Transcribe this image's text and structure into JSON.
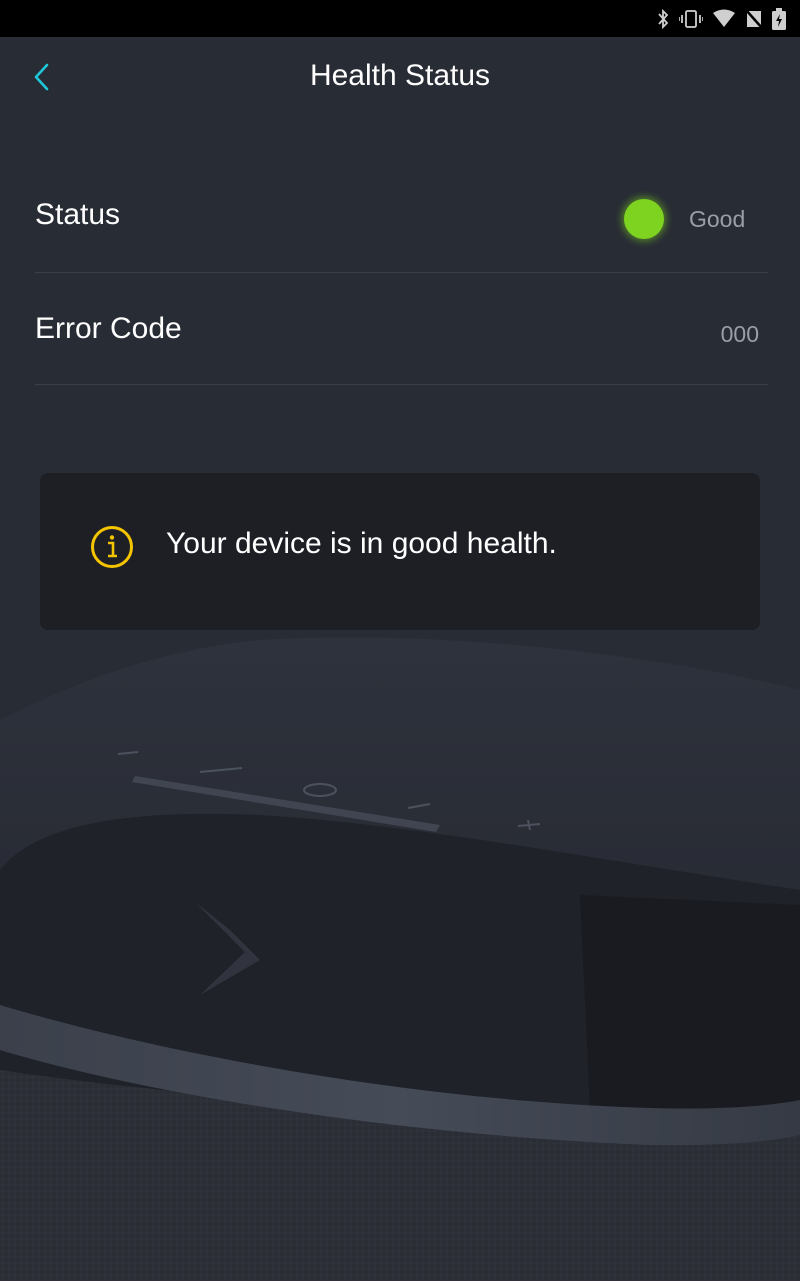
{
  "status_bar": {
    "icons": [
      "bluetooth-icon",
      "vibrate-icon",
      "wifi-icon",
      "no-sim-icon",
      "battery-charging-icon"
    ]
  },
  "header": {
    "title": "Health Status",
    "back_icon": "chevron-left-icon"
  },
  "rows": [
    {
      "label": "Status",
      "value": "Good",
      "indicator_color": "#7ed321"
    },
    {
      "label": "Error Code",
      "value": "000"
    }
  ],
  "info_card": {
    "icon": "info-icon",
    "message": "Your device is in good health."
  },
  "colors": {
    "background": "#282c35",
    "accent": "#1fc8d8",
    "info_icon": "#f5c400",
    "good_indicator": "#7ed321",
    "card_background": "#1d1f24"
  }
}
